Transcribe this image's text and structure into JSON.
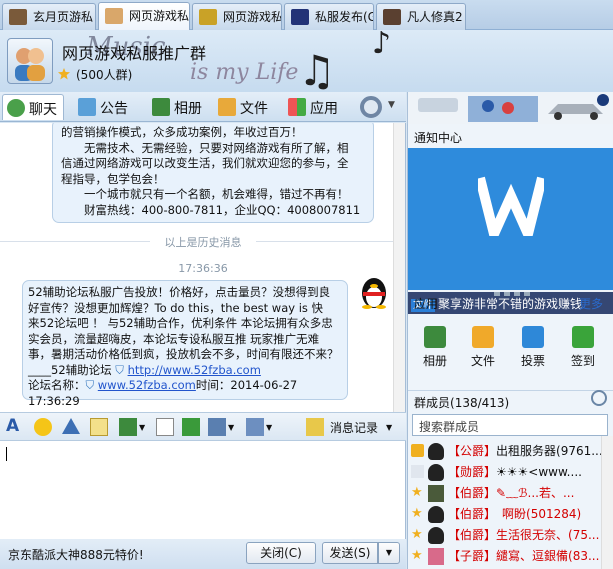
{
  "tabs": [
    {
      "label": "玄月页游私"
    },
    {
      "label": "网页游戏私"
    },
    {
      "label": "网页游戏私"
    },
    {
      "label": "私服发布(G"
    },
    {
      "label": "凡人修真2"
    }
  ],
  "group": {
    "name": "网页游戏私服推广群",
    "members_label": "(500人群)",
    "deco_text": "Music",
    "deco_text2": "is my Life"
  },
  "toolbar": {
    "items": [
      "聊天",
      "公告",
      "相册",
      "文件",
      "应用"
    ]
  },
  "chat": {
    "history_lines": [
      "的营销操作模式，众多成功案例，年收过百万！",
      "　　无需技术、无需经验，只要对网络游戏有所了解，相",
      "信通过网络游戏可以改变生活，我们就欢迎您的参与，全",
      "程指导，包学包会！",
      "　　一个城市就只有一个名额，机会难得，错过不再有！",
      "　　财富热线：400-800-7811，企业QQ：4008007811"
    ],
    "history_separator": "以上是历史消息",
    "timestamp": "17:36:36",
    "message_lines": [
      "52辅助论坛私服广告投放！价格好，点击量员？没想得到良",
      "好宣传？没想更加辉煌？To do this，the best way is 快",
      "来52论坛吧 ！ 与52辅助合作，优利条件 本论坛拥有众多忠",
      "实会员，流量超嗨皮，本论坛专设私服互推 玩家推广无难",
      "事，暑期活动价格低到疯，投放机会不多，时间有限还不来？"
    ],
    "forum_label": "____52辅助论坛",
    "forum_url": "http://www.52fzba.com",
    "forum_name_label": "论坛名称：",
    "forum_url2": "www.52fzba.com",
    "time_label": "时间：2014-06-27 17:36:29"
  },
  "format_bar": {
    "history_label": "消息记录"
  },
  "bottom": {
    "ad_text": "京东酷派大神888元特价!",
    "close_label": "关闭(C)",
    "send_label": "发送(S)"
  },
  "right": {
    "notice_title": "通知中心",
    "promo_tag": "文件",
    "promo_text": "聚享游非常不错的游戏赚钱",
    "apps_title": "应用",
    "more_label": "更多",
    "apps": [
      "相册",
      "文件",
      "投票",
      "签到"
    ],
    "members_title": "群成员",
    "members_count": "(138/413)",
    "search_placeholder": "搜索群成员",
    "members": [
      {
        "rank": "【公爵】",
        "name": "出租服务器(9761..."
      },
      {
        "rank": "【勋爵】",
        "name": "☀☀☀<www...."
      },
      {
        "rank": "【伯爵】",
        "name": "✎﹏ℬ...若、..."
      },
      {
        "rank": "【伯爵】",
        "name": "　啊盼(501284)"
      },
      {
        "rank": "【伯爵】",
        "name": "生活很无奈、(75..."
      },
      {
        "rank": "【子爵】",
        "name": "繾寫、逗銀備(83..."
      }
    ]
  },
  "colors": {
    "accent": "#2e8bdc",
    "rank_red": "#d40000",
    "link": "#2255cc"
  }
}
